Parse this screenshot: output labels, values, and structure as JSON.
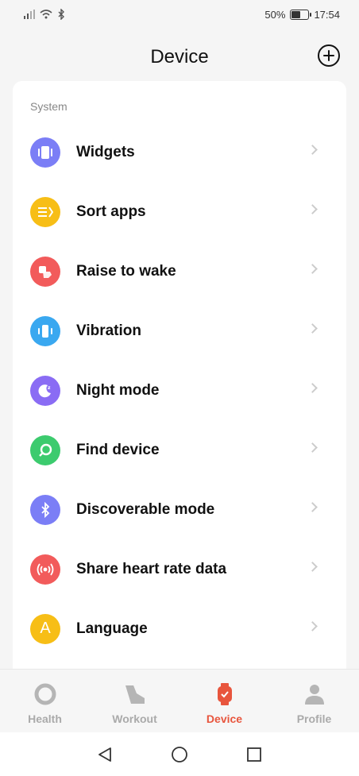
{
  "status": {
    "battery": "50%",
    "time": "17:54"
  },
  "header": {
    "title": "Device"
  },
  "section": {
    "label": "System"
  },
  "items": [
    {
      "label": "Widgets",
      "icon": "widgets-icon",
      "color": "#7b7ef6"
    },
    {
      "label": "Sort apps",
      "icon": "sort-apps-icon",
      "color": "#f7be16"
    },
    {
      "label": "Raise to wake",
      "icon": "raise-to-wake-icon",
      "color": "#f25b5b"
    },
    {
      "label": "Vibration",
      "icon": "vibration-icon",
      "color": "#3aa8f0"
    },
    {
      "label": "Night mode",
      "icon": "moon-icon",
      "color": "#8a6cf4"
    },
    {
      "label": "Find device",
      "icon": "search-icon",
      "color": "#3ccb6e"
    },
    {
      "label": "Discoverable mode",
      "icon": "bluetooth-icon",
      "color": "#7b7ef6"
    },
    {
      "label": "Share heart rate data",
      "icon": "broadcast-icon",
      "color": "#f25b5b"
    },
    {
      "label": "Language",
      "icon": "language-icon",
      "color": "#f7be16",
      "glyph": "A"
    }
  ],
  "tabs": [
    {
      "label": "Health",
      "icon": "health-icon"
    },
    {
      "label": "Workout",
      "icon": "workout-icon"
    },
    {
      "label": "Device",
      "icon": "watch-icon",
      "active": true
    },
    {
      "label": "Profile",
      "icon": "profile-icon"
    }
  ],
  "colors": {
    "accent": "#e8553d",
    "tab_inactive": "#aaaaaa"
  }
}
